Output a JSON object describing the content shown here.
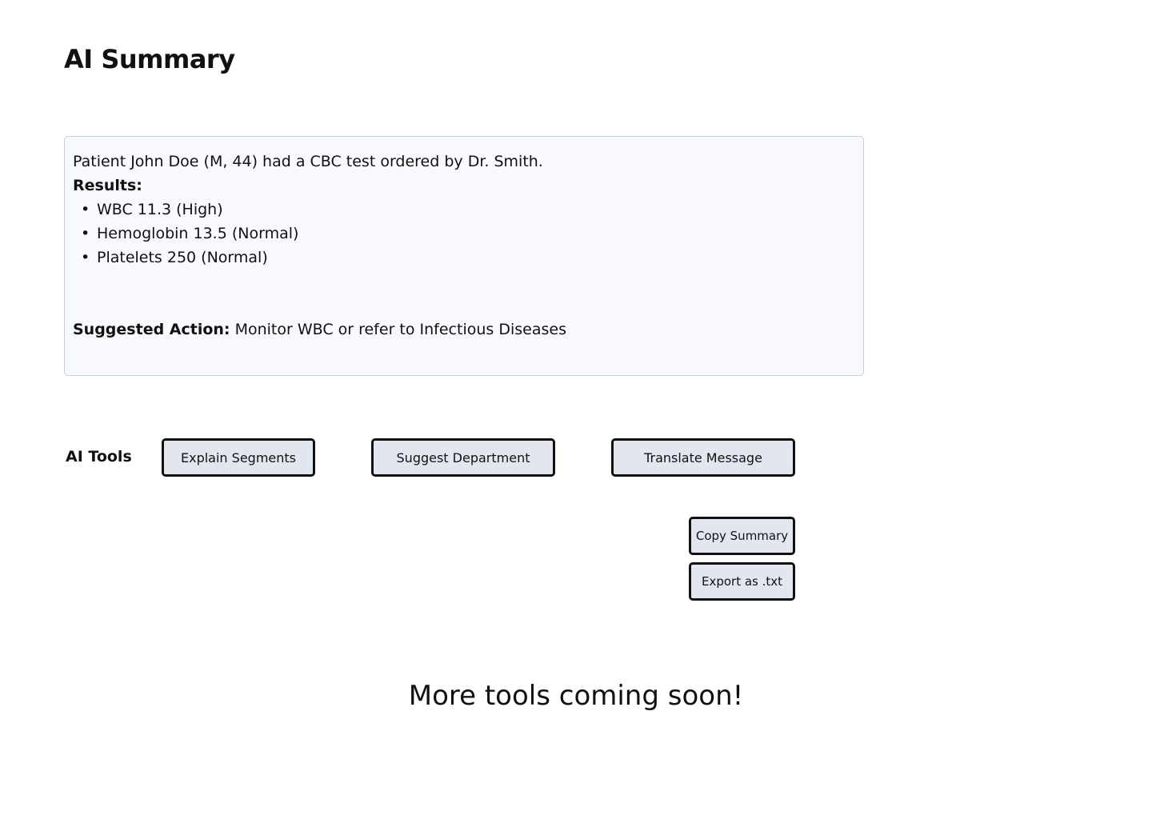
{
  "page": {
    "title": "AI Summary"
  },
  "summary": {
    "intro": "Patient John Doe (M, 44) had a CBC test ordered by Dr. Smith.",
    "results_label": "Results:",
    "results": [
      "WBC 11.3 (High)",
      "Hemoglobin 13.5 (Normal)",
      "Platelets 250 (Normal)"
    ],
    "bullet": "•",
    "action_label": "Suggested Action:",
    "action_text": " Monitor WBC or refer to Infectious Diseases"
  },
  "tools": {
    "label": "AI Tools",
    "explain_label": "Explain Segments",
    "suggest_label": "Suggest Department",
    "translate_label": "Translate Message",
    "copy_label": "Copy Summary",
    "export_label": "Export as .txt"
  },
  "footer": {
    "message": "More tools coming soon!"
  }
}
